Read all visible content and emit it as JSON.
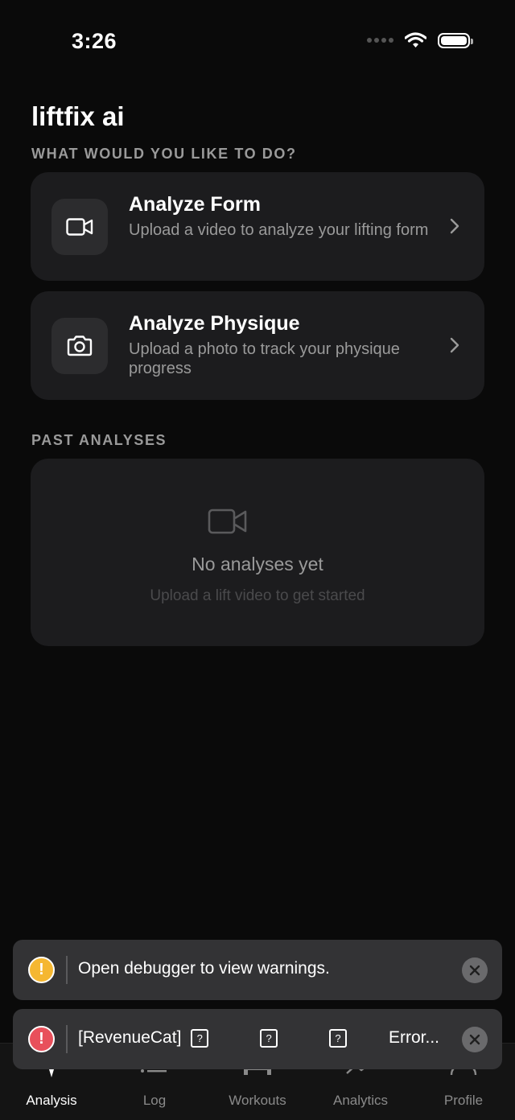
{
  "status_bar": {
    "time": "3:26"
  },
  "app": {
    "title": "liftfix ai",
    "section_actions": "WHAT WOULD YOU LIKE TO DO?",
    "section_past": "PAST ANALYSES"
  },
  "actions": [
    {
      "title": "Analyze Form",
      "description": "Upload a video to analyze your lifting form",
      "icon": "video-camera-icon"
    },
    {
      "title": "Analyze Physique",
      "description": "Upload a photo to track your physique progress",
      "icon": "camera-icon"
    }
  ],
  "empty_state": {
    "title": "No analyses yet",
    "subtitle": "Upload a lift video to get started",
    "icon": "video-camera-icon"
  },
  "toasts": {
    "warning": {
      "message": "Open debugger to view warnings.",
      "badge": "!",
      "color": "#f5b731"
    },
    "error": {
      "message_prefix": "[RevenueCat]",
      "box": "?",
      "message_suffix": "Error...",
      "badge": "!",
      "color": "#e8505b"
    }
  },
  "tabs": [
    {
      "label": "Analysis",
      "icon": "analysis-icon",
      "active": true
    },
    {
      "label": "Log",
      "icon": "list-icon",
      "active": false
    },
    {
      "label": "Workouts",
      "icon": "dumbbell-icon",
      "active": false
    },
    {
      "label": "Analytics",
      "icon": "chart-icon",
      "active": false
    },
    {
      "label": "Profile",
      "icon": "person-icon",
      "active": false
    }
  ],
  "colors": {
    "background": "#0a0a0a",
    "card": "#1c1c1e",
    "muted_text": "#9a9a9a"
  }
}
